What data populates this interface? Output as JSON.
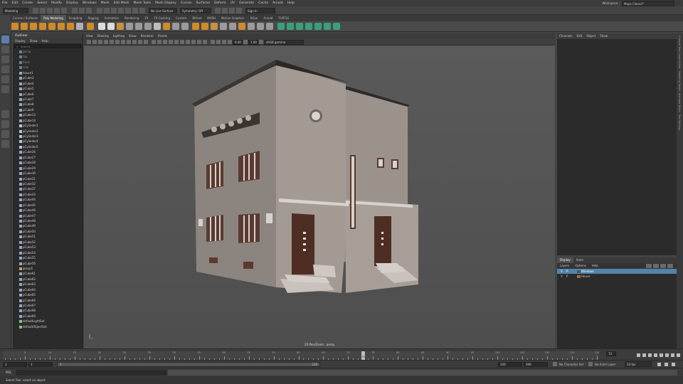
{
  "menubar": {
    "items": [
      "File",
      "Edit",
      "Create",
      "Select",
      "Modify",
      "Display",
      "Windows",
      "Mesh",
      "Edit Mesh",
      "Mesh Tools",
      "Mesh Display",
      "Curves",
      "Surfaces",
      "Deform",
      "UV",
      "Generate",
      "Cache",
      "Arnold",
      "Help"
    ],
    "workspace_label": "Workspace :",
    "workspace_value": "Maya Classic*"
  },
  "statusline": {
    "menuset": "Modeling",
    "live_surface": "No Live Surface",
    "symmetry": "Symmetry: Off",
    "sign_in": "Sign In"
  },
  "shelf": {
    "tabs": [
      "Curves / Surfaces",
      "Poly Modeling",
      "Sculpting",
      "Rigging",
      "Animation",
      "Rendering",
      "FX",
      "FX Caching",
      "Custom",
      "Bifrost",
      "MASH",
      "Motion Graphics",
      "XGen",
      "Arnold",
      "TURTLE"
    ],
    "active_tab": "Poly Modeling"
  },
  "outliner": {
    "title": "Outliner",
    "menu": [
      "Display",
      "Show",
      "Help"
    ],
    "search_placeholder": "Search...",
    "items": [
      "persp",
      "top",
      "front",
      "side",
      "house1",
      "pCube3",
      "pCube4",
      "pCube5",
      "pCube6",
      "pCube7",
      "pCube8",
      "pCube9",
      "pCube13",
      "pCube14",
      "pCylinder1",
      "pCylinder2",
      "pCylinder3",
      "pCylinder4",
      "pCylinder5",
      "pCube26",
      "pCube27",
      "pCube28",
      "pCube29",
      "pCube30",
      "pCube31",
      "pCube32",
      "pCube37",
      "pCube43",
      "pCube44",
      "pCube45",
      "pCube46",
      "pCube47",
      "pCube48",
      "pCube49",
      "pCube50",
      "pCube51",
      "pCube52",
      "pCube53",
      "pCube54",
      "pCube55",
      "pCube56",
      "group1",
      "pCube61",
      "pCube62",
      "pCube63",
      "pCube64",
      "pCube65",
      "pCube66",
      "pCube67",
      "pCube68",
      "pCube69",
      "defaultLightSet",
      "defaultObjectSet"
    ]
  },
  "viewport": {
    "menu": [
      "View",
      "Shading",
      "Lighting",
      "Show",
      "Renderer",
      "Panels"
    ],
    "exposure": "0.00",
    "gamma": "1.00",
    "color_space": "sRGB gamma",
    "camera_label": "2D Pan/Zoom : persp"
  },
  "channelbox": {
    "menu": [
      "Channels",
      "Edit",
      "Object",
      "Show"
    ]
  },
  "side_tabs": [
    "Channel Box / Layer Editor",
    "Modeling Toolkit",
    "Attribute Editor",
    "Tool Settings"
  ],
  "layers": {
    "tabs": [
      "Display",
      "Anim"
    ],
    "active_tab": "Display",
    "menu": [
      "Layers",
      "Options",
      "Help"
    ],
    "rows": [
      {
        "v": "V",
        "p": "P",
        "name": "Windows",
        "color": "#3a5a8a",
        "selected": true
      },
      {
        "v": "V",
        "p": "P",
        "name": "House",
        "color": "#b06a30",
        "selected": false
      }
    ]
  },
  "timeline": {
    "ticks": [
      "5",
      "10",
      "15",
      "20",
      "25",
      "30",
      "35",
      "40",
      "45",
      "50",
      "55",
      "60",
      "65",
      "70",
      "75",
      "80",
      "85",
      "90",
      "95",
      "100",
      "105",
      "110",
      "115",
      "120"
    ],
    "current_frame": "73",
    "current_frame_field": "73"
  },
  "range": {
    "start": "1",
    "start2": "1",
    "range_start": "1",
    "range_end": "120",
    "end": "120",
    "end2": "200",
    "character_set": "No Character Set",
    "anim_layer": "No Anim Layer",
    "fps": "24 fps"
  },
  "cmdline": {
    "label": "MEL"
  },
  "helpline": {
    "text": "Select Tool: select an object"
  }
}
